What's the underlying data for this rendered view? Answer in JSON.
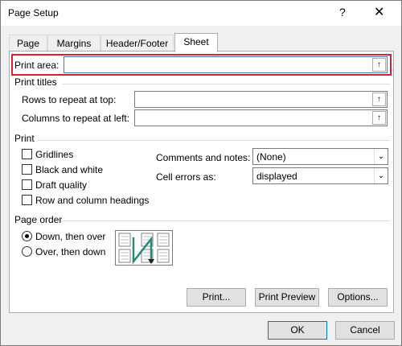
{
  "dialog": {
    "title": "Page Setup",
    "help_glyph": "?",
    "close_glyph": "✕"
  },
  "tabs": [
    {
      "label": "Page"
    },
    {
      "label": "Margins"
    },
    {
      "label": "Header/Footer"
    },
    {
      "label": "Sheet"
    }
  ],
  "print_area": {
    "label": "Print area:",
    "value": ""
  },
  "print_titles": {
    "heading": "Print titles",
    "rows_label": "Rows to repeat at top:",
    "rows_value": "",
    "cols_label": "Columns to repeat at left:",
    "cols_value": ""
  },
  "print": {
    "heading": "Print",
    "gridlines": "Gridlines",
    "black_white": "Black and white",
    "draft": "Draft quality",
    "headings": "Row and column headings",
    "comments_label": "Comments and notes:",
    "comments_value": "(None)",
    "errors_label": "Cell errors as:",
    "errors_value": "displayed"
  },
  "page_order": {
    "heading": "Page order",
    "down_over": "Down, then over",
    "over_down": "Over, then down"
  },
  "buttons": {
    "print": "Print...",
    "preview": "Print Preview",
    "options": "Options...",
    "ok": "OK",
    "cancel": "Cancel"
  },
  "icons": {
    "collapse": "↑",
    "dropdown": "⌄"
  }
}
